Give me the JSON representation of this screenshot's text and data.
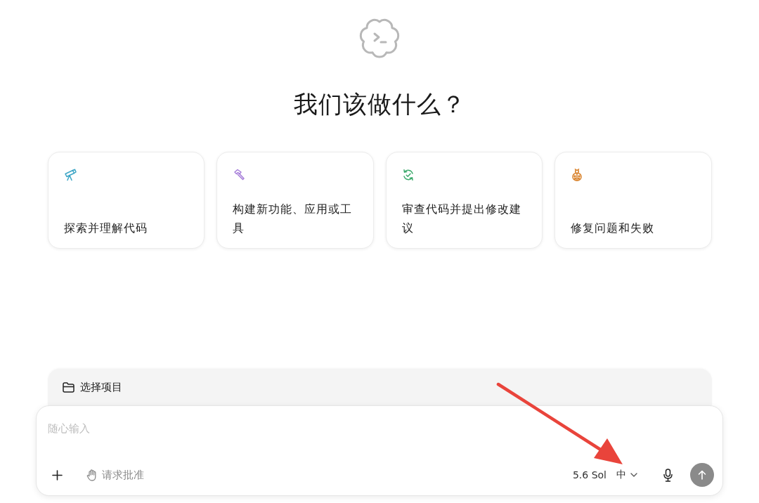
{
  "heading": "我们该做什么？",
  "suggestions": [
    {
      "kind": "telescope",
      "color": "#3ea6c6",
      "label": "探索并理解代码"
    },
    {
      "kind": "hammer",
      "color": "#a47bd8",
      "label": "构建新功能、应用或工具"
    },
    {
      "kind": "review",
      "color": "#3aa86a",
      "label": "审查代码并提出修改建议"
    },
    {
      "kind": "bug",
      "color": "#d9822b",
      "label": "修复问题和失败"
    }
  ],
  "project_picker": {
    "label": "选择项目"
  },
  "composer": {
    "placeholder": "随心输入",
    "approval_mode": "请求批准",
    "model": "5.6 Sol",
    "reasoning": "中"
  },
  "annotations": [
    {
      "kind": "arrow"
    }
  ]
}
